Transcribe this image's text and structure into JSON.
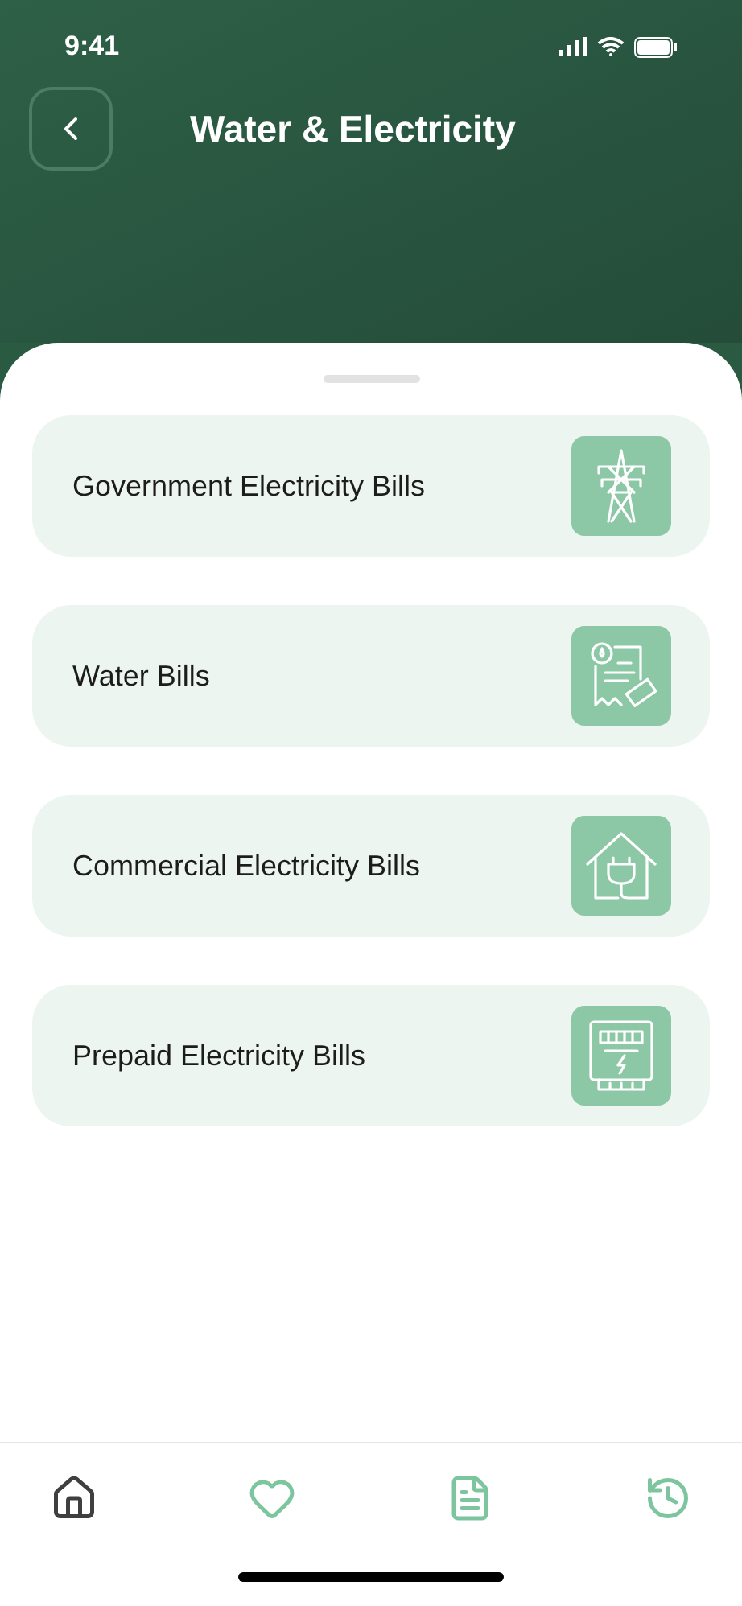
{
  "status_bar": {
    "time": "9:41"
  },
  "header": {
    "title": "Water & Electricity"
  },
  "services": [
    {
      "label": "Government Electricity Bills",
      "kind": "tower"
    },
    {
      "label": "Water Bills",
      "kind": "bill"
    },
    {
      "label": "Commercial Electricity Bills",
      "kind": "house"
    },
    {
      "label": "Prepaid Electricity Bills",
      "kind": "meter"
    }
  ],
  "nav": [
    {
      "kind": "home",
      "selected": true
    },
    {
      "kind": "heart",
      "selected": false
    },
    {
      "kind": "list",
      "selected": false
    },
    {
      "kind": "history",
      "selected": false
    }
  ]
}
